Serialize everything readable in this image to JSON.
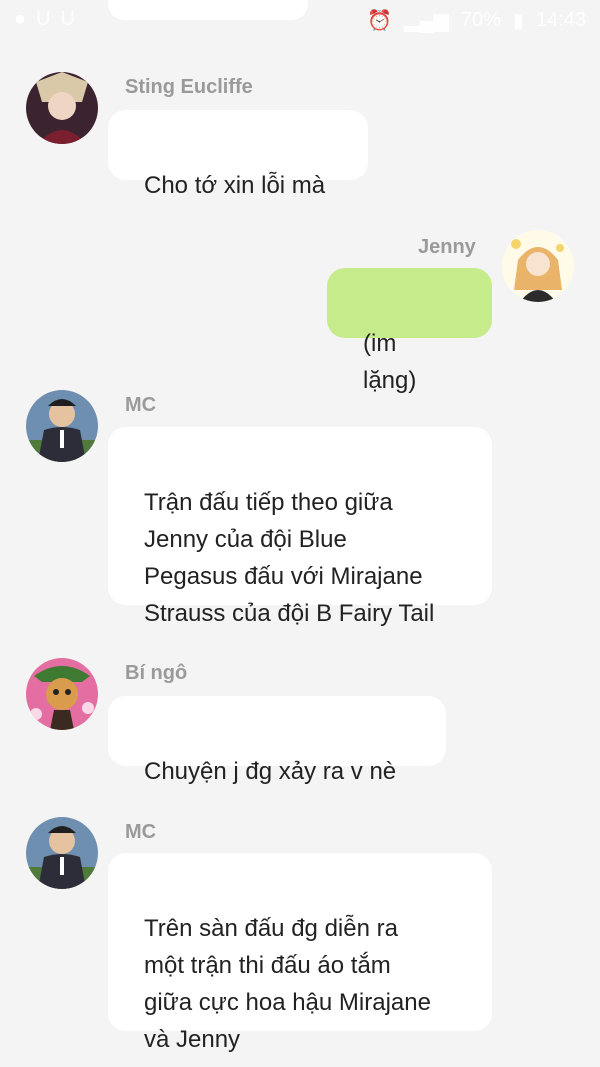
{
  "status_bar": {
    "battery_percent": "70%",
    "time": "14:43"
  },
  "messages": [
    {
      "sender": "Sting Eucliffe",
      "text": "Cho tớ xin lỗi mà",
      "mine": false
    },
    {
      "sender": "Jenny",
      "text": "(im lặng)",
      "mine": true
    },
    {
      "sender": "MC",
      "text": "Trận đấu tiếp theo giữa\nJenny của đội Blue\nPegasus đấu với Mirajane\nStrauss của đội B Fairy Tail",
      "mine": false
    },
    {
      "sender": "Bí ngô",
      "text": "Chuyện j đg xảy ra v nè",
      "mine": false
    },
    {
      "sender": "MC",
      "text": "Trên sàn đấu đg diễn ra\nmột trận thi đấu áo tắm\ngiữa cực hoa hậu Mirajane\nvà Jenny",
      "mine": false
    }
  ]
}
